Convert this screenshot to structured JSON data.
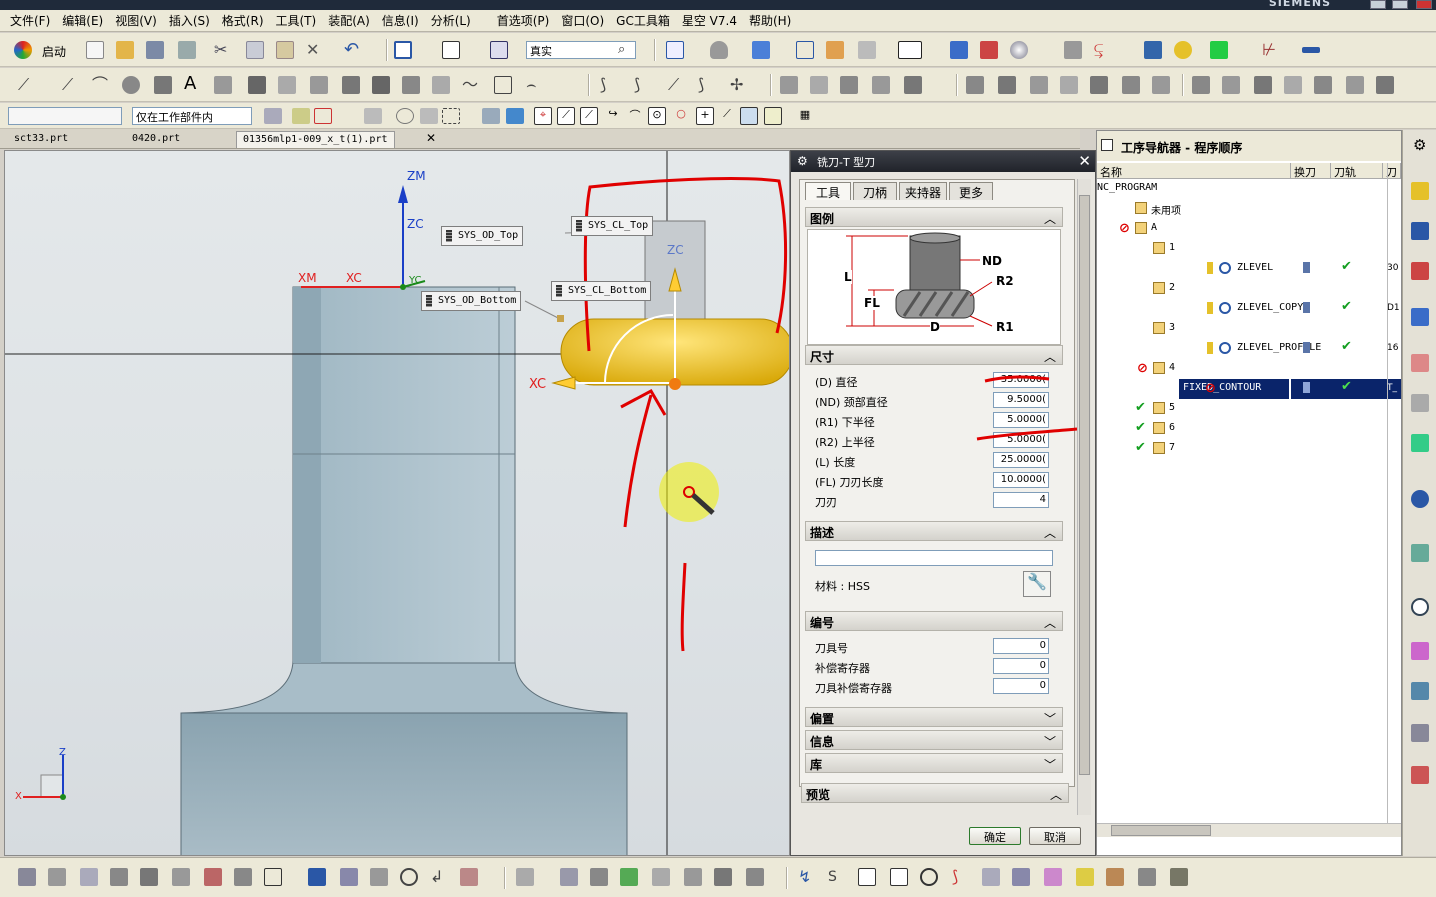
{
  "app": {
    "brand": "SIEMENS"
  },
  "menu": [
    "文件(F)",
    "编辑(E)",
    "视图(V)",
    "插入(S)",
    "格式(R)",
    "工具(T)",
    "装配(A)",
    "信息(I)",
    "分析(L)",
    "首选项(P)",
    "窗口(O)",
    "GC工具箱",
    "星空 V7.4",
    "帮助(H)"
  ],
  "toolbar": {
    "start_label": "启动",
    "render_mode": "真实",
    "filter_mode": "仅在工作部件内"
  },
  "file_tabs": [
    "sct33.prt",
    "0420.prt",
    "01356mlp1-009_x_t(1).prt"
  ],
  "viewport": {
    "labels": {
      "zm": "ZM",
      "zc": "ZC",
      "xm": "XM",
      "xc": "XC",
      "yc": "YC",
      "zc2": "ZC",
      "xc2": "XC",
      "y_axis": "Z",
      "x_axis": "X"
    },
    "tags": [
      "SYS_OD_Top",
      "SYS_CL_Top",
      "SYS_CL_Bottom",
      "SYS_OD_Bottom"
    ]
  },
  "dialog": {
    "title": "铣刀-T 型刀",
    "tabs": [
      "工具",
      "刀柄",
      "夹持器",
      "更多"
    ],
    "sections": {
      "legend": "图例",
      "dims": "尺寸",
      "desc": "描述",
      "num": "编号",
      "offset": "偏置",
      "info": "信息",
      "lib": "库",
      "preview": "预览"
    },
    "legend_labels": {
      "nd": "ND",
      "r2": "R2",
      "l": "L",
      "fl": "FL",
      "d": "D",
      "r1": "R1"
    },
    "dims": [
      {
        "label": "(D) 直径",
        "value": "35.0000("
      },
      {
        "label": "(ND) 颈部直径",
        "value": "9.5000("
      },
      {
        "label": "(R1) 下半径",
        "value": "5.0000("
      },
      {
        "label": "(R2) 上半径",
        "value": "5.0000("
      },
      {
        "label": "(L) 长度",
        "value": "25.0000("
      },
      {
        "label": "(FL) 刀刃长度",
        "value": "10.0000("
      },
      {
        "label": "刀刃",
        "value": "4"
      }
    ],
    "material": "材料 : HSS",
    "numbering": [
      {
        "label": "刀具号",
        "value": "0"
      },
      {
        "label": "补偿寄存器",
        "value": "0"
      },
      {
        "label": "刀具补偿寄存器",
        "value": "0"
      }
    ],
    "ok": "确定",
    "cancel": "取消"
  },
  "navigator": {
    "title": "工序导航器 - 程序顺序",
    "columns": [
      "名称",
      "换刀",
      "刀轨",
      "刀"
    ],
    "rows": [
      {
        "name": "NC_PROGRAM",
        "indent": 0
      },
      {
        "name": "未用项",
        "indent": 1
      },
      {
        "name": "A",
        "indent": 1
      },
      {
        "name": "1",
        "indent": 2
      },
      {
        "name": "ZLEVEL",
        "indent": 3,
        "extra": "30"
      },
      {
        "name": "2",
        "indent": 2
      },
      {
        "name": "ZLEVEL_COPY",
        "indent": 3,
        "extra": "D1"
      },
      {
        "name": "3",
        "indent": 2
      },
      {
        "name": "ZLEVEL_PROFILE",
        "indent": 3,
        "extra": "16"
      },
      {
        "name": "4",
        "indent": 2
      },
      {
        "name": "FIXED_CONTOUR",
        "indent": 3,
        "extra": "T_",
        "selected": true
      },
      {
        "name": "5",
        "indent": 2
      },
      {
        "name": "6",
        "indent": 2
      },
      {
        "name": "7",
        "indent": 2
      }
    ]
  },
  "colors": {
    "accent": "#0a246a",
    "annotation": "#e00000",
    "tool": "#f0c419",
    "check": "#139e20"
  }
}
